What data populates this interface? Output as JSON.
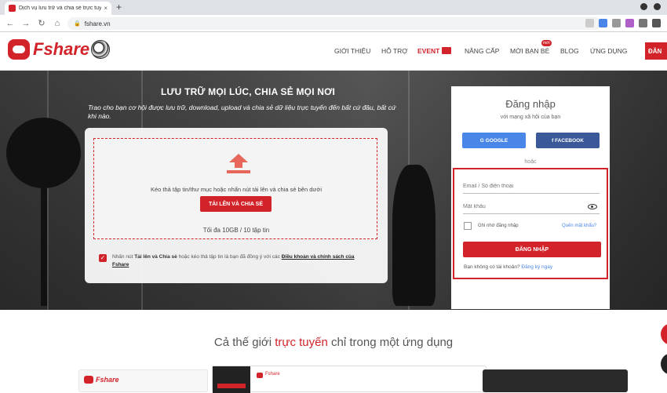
{
  "browser": {
    "tab_title": "Dịch vụ lưu trữ và chia sẻ trực tuyến",
    "tab_close": "×",
    "new_tab": "+",
    "url": "fshare.vn",
    "back_icon": "arrow-left-icon",
    "forward_icon": "arrow-right-icon",
    "reload_icon": "reload-icon",
    "lock_icon": "lock-icon"
  },
  "header": {
    "logo_text": "Fshare",
    "nav": [
      {
        "label": "GIỚI THIỆU"
      },
      {
        "label": "HỖ TRỢ"
      },
      {
        "label": "EVENT"
      },
      {
        "label": "NÂNG CẤP"
      },
      {
        "label": "MỜI BẠN BÈ",
        "badge": "mới"
      },
      {
        "label": "BLOG"
      },
      {
        "label": "ỨNG DỤNG"
      }
    ],
    "signup_label": "ĐĂN"
  },
  "hero": {
    "title": "LƯU TRỮ MỌI LÚC, CHIA SẺ MỌI NƠI",
    "subtitle": "Trao cho bạn cơ hội được lưu trữ, download, upload và chia sẻ dữ liệu trực tuyến đến bất cứ đâu, bất cứ khi nào."
  },
  "upload": {
    "drop_text": "Kéo thả tập tin/thư mục hoặc nhấn nút tải lên và chia sẻ bên dưới",
    "button_label": "TẢI LÊN VÀ CHIA SẺ",
    "limit_text": "Tối đa 10GB / 10 tập tin",
    "terms_prefix": "Nhấn nút",
    "terms_bold": "Tải lên và Chia sẻ",
    "terms_middle": "hoặc kéo thả tập tin là bạn đã đồng ý với các",
    "terms_link": "Điều khoản và chính sách của Fshare",
    "check_mark": "✓"
  },
  "login": {
    "title": "Đăng nhập",
    "subtitle": "với mạng xã hội của bạn",
    "google_label": "GOOGLE",
    "facebook_label": "FACEBOOK",
    "or_label": "hoặc",
    "email_placeholder": "Email / Số điện thoại",
    "password_placeholder": "Mật khẩu",
    "remember_label": "Ghi nhớ đăng nhập",
    "forgot_label": "Quên mật khẩu?",
    "submit_label": "ĐĂNG NHẬP",
    "no_account": "Bạn không có tài khoản?",
    "register_label": "Đăng ký ngay"
  },
  "bottom": {
    "tagline_start": "Cả thế giới",
    "tagline_highlight": "trực tuyến",
    "tagline_end": "chỉ trong một ứng dụng",
    "preview_logo_text": "Fshare",
    "preview_small_text": "Fshare"
  },
  "colors": {
    "brand_red": "#d2232a",
    "google_blue": "#4a86e8",
    "facebook_blue": "#3b5998"
  }
}
